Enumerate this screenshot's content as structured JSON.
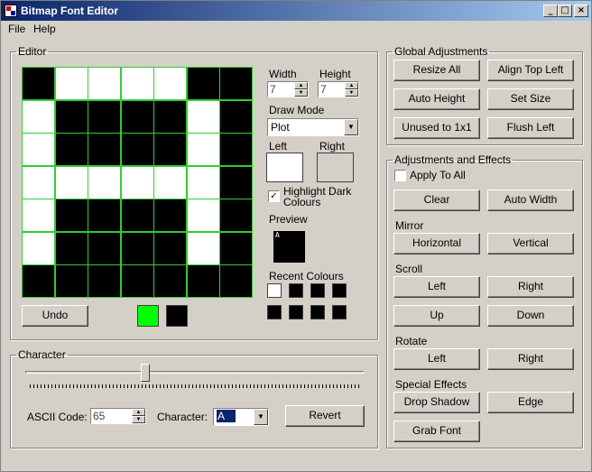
{
  "window": {
    "title": "Bitmap Font Editor"
  },
  "menu": {
    "file": "File",
    "help": "Help"
  },
  "editor": {
    "legend": "Editor",
    "grid": [
      [
        1,
        0,
        0,
        0,
        0,
        1,
        1
      ],
      [
        0,
        1,
        1,
        1,
        1,
        0,
        1
      ],
      [
        0,
        1,
        1,
        1,
        1,
        0,
        1
      ],
      [
        0,
        0,
        0,
        0,
        0,
        0,
        1
      ],
      [
        0,
        1,
        1,
        1,
        1,
        0,
        1
      ],
      [
        0,
        1,
        1,
        1,
        1,
        0,
        1
      ],
      [
        1,
        1,
        1,
        1,
        1,
        1,
        1
      ]
    ],
    "colors": {
      "on": "#000000",
      "off": "#ffffff",
      "gridline": "#33cc33"
    },
    "undo": "Undo",
    "width_label": "Width",
    "width_value": "7",
    "height_label": "Height",
    "height_value": "7",
    "draw_mode_label": "Draw Mode",
    "draw_mode_value": "Plot",
    "left_label": "Left",
    "right_label": "Right",
    "left_color": "#ffffff",
    "right_color": "#d4d0c8",
    "highlight_label_1": "Highlight Dark",
    "highlight_label_2": "Colours",
    "highlight_checked": "✓",
    "preview_label": "Preview",
    "preview_char": "A",
    "recent_label": "Recent Colours",
    "recent_colors": [
      "#ffffff",
      "#000000",
      "#000000",
      "#000000",
      "#000000",
      "#000000",
      "#000000",
      "#000000"
    ],
    "color_a": "#00ff00",
    "color_b": "#000000"
  },
  "character": {
    "legend": "Character",
    "slider_fraction": 0.35,
    "ascii_label": "ASCII Code:",
    "ascii_value": "65",
    "char_label": "Character:",
    "char_value": "A",
    "revert": "Revert"
  },
  "global": {
    "legend": "Global Adjustments",
    "resize_all": "Resize All",
    "align_top_left": "Align Top Left",
    "auto_height": "Auto Height",
    "set_size": "Set Size",
    "unused_1x1": "Unused to 1x1",
    "flush_left": "Flush Left"
  },
  "adjust": {
    "legend": "Adjustments and Effects",
    "apply_all": "Apply To All",
    "clear": "Clear",
    "auto_width": "Auto Width",
    "mirror_label": "Mirror",
    "horizontal": "Horizontal",
    "vertical": "Vertical",
    "scroll_label": "Scroll",
    "left": "Left",
    "right": "Right",
    "up": "Up",
    "down": "Down",
    "rotate_label": "Rotate",
    "rot_left": "Left",
    "rot_right": "Right",
    "special_label": "Special Effects",
    "drop_shadow": "Drop Shadow",
    "edge": "Edge",
    "grab_font": "Grab Font"
  }
}
